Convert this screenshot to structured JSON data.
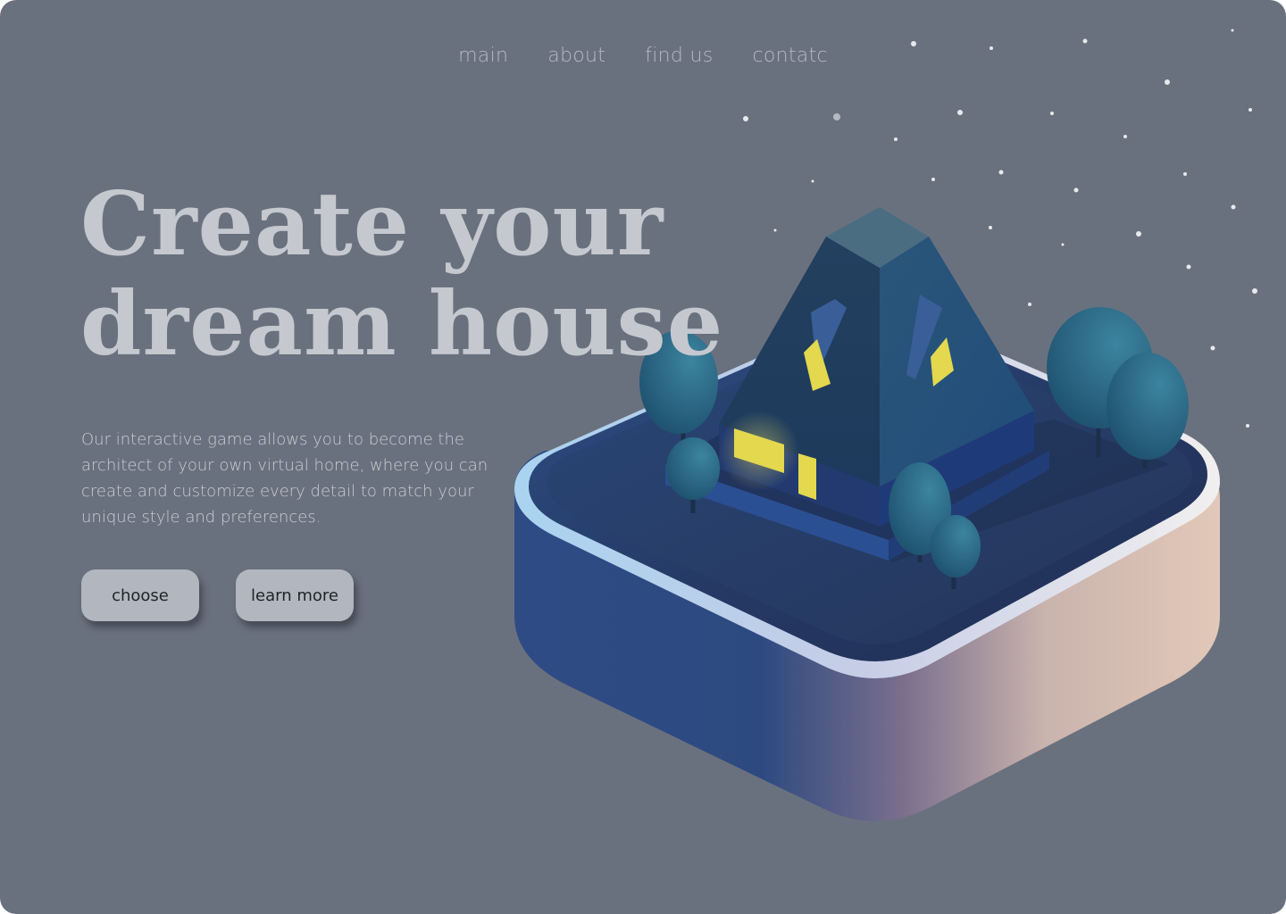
{
  "nav": {
    "items": [
      {
        "label": "main"
      },
      {
        "label": "about"
      },
      {
        "label": "find us"
      },
      {
        "label": "contatc"
      }
    ]
  },
  "hero": {
    "title_line1": "Create your",
    "title_line2": "dream house",
    "description": "Our interactive game allows you to become the architect of your own virtual home, where you can create and customize every detail to match your unique style and preferences.",
    "choose_label": "choose",
    "learn_more_label": "learn more"
  },
  "illustration": {
    "subject": "isometric-house-icon",
    "window_color": "#e3d84e",
    "background_color": "#6a717e"
  }
}
